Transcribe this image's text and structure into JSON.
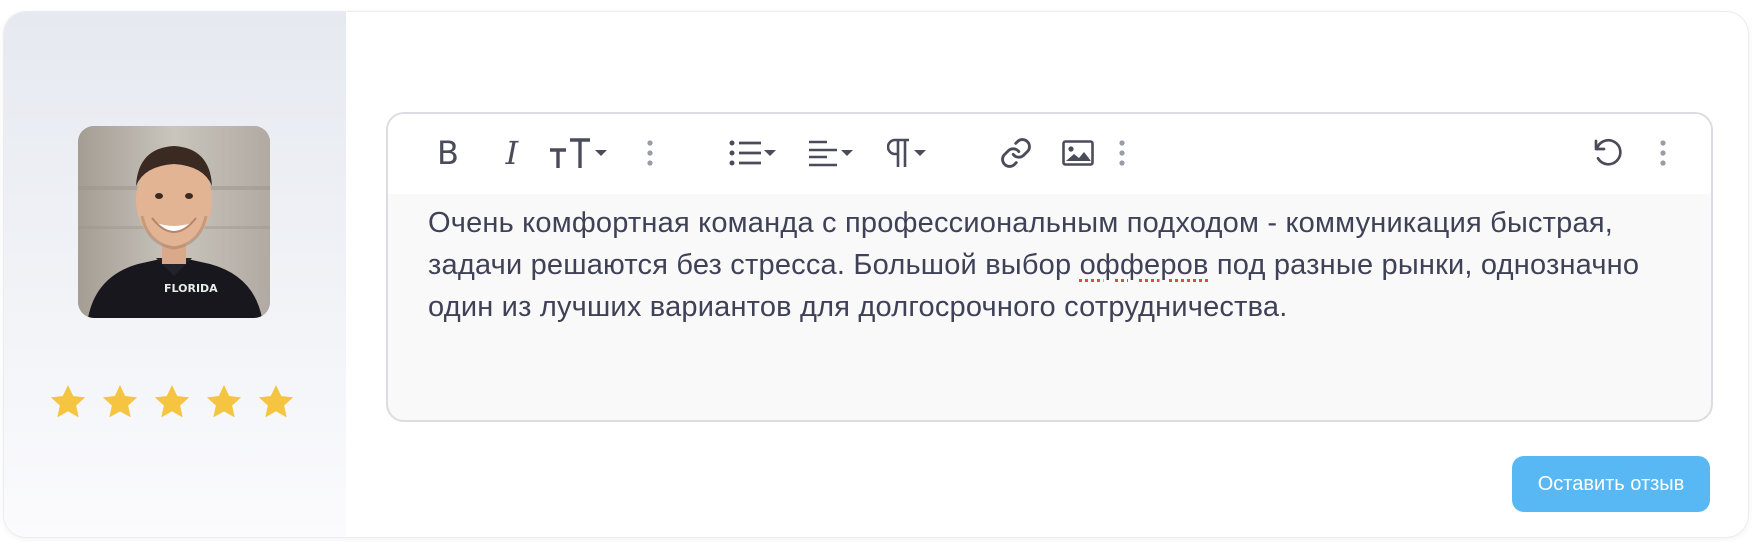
{
  "review": {
    "rating": 5,
    "max_rating": 5,
    "avatar_shirt_text": "FLORIDA",
    "text_before": "Очень комфортная команда с профессиональным подходом - коммуникация быстрая, задачи решаются без стресса. Большой выбор ",
    "text_misspelled": "офферов",
    "text_after": " под разные рынки, однозначно один из лучших вариантов для долгосрочного сотрудничества.",
    "submit_label": "Оставить отзыв"
  },
  "toolbar": {
    "bold_label": "B",
    "italic_label": "I",
    "icons": [
      "bold-icon",
      "italic-icon",
      "text-size-icon",
      "more-icon",
      "bulleted-list-icon",
      "align-left-icon",
      "paragraph-icon",
      "link-icon",
      "image-icon",
      "more-icon",
      "undo-icon",
      "more-icon"
    ]
  },
  "colors": {
    "star": "#f5c542",
    "button": "#58b8f3",
    "text": "#3f4157"
  }
}
